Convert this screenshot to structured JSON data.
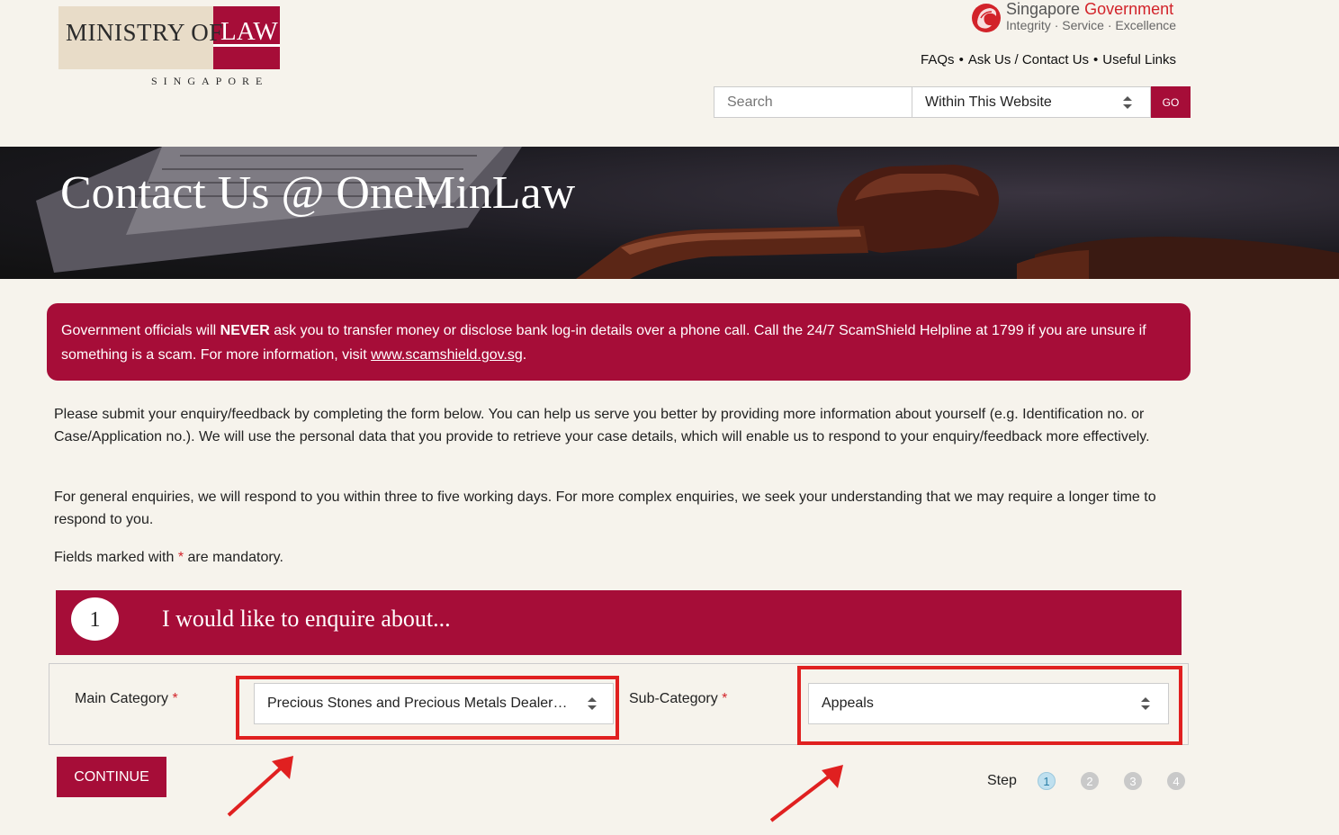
{
  "header": {
    "logo": {
      "ministry": "MINISTRY OF",
      "law": "LAW",
      "country": "SINGAPORE"
    },
    "sg_gov": {
      "name_part1": "Singapore",
      "name_part2": "Government",
      "motto": "Integrity · Service · Excellence"
    },
    "links": [
      "FAQs",
      "Ask Us / Contact Us",
      "Useful Links"
    ],
    "search": {
      "placeholder": "Search",
      "scope": "Within This Website",
      "go_label": "GO"
    }
  },
  "banner": {
    "title": "Contact Us @ OneMinLaw"
  },
  "alert": {
    "text_before": "Government officials will ",
    "bold": "NEVER",
    "text_after": " ask you to transfer money or disclose bank log-in details over a phone call. Call the 24/7 ScamShield Helpline at 1799 if you are unsure if something is a scam. For more information, visit ",
    "link": "www.scamshield.gov.sg",
    "end": "."
  },
  "intro": {
    "p1": "Please submit your enquiry/feedback by completing the form below. You can help us serve you better by providing more information about yourself (e.g. Identification no. or Case/Application no.). We will use the personal data that you provide to retrieve your case details, which will enable us to respond to your enquiry/feedback more effectively.",
    "p2": "For general enquiries, we will respond to you within three to five working days. For more complex enquiries, we seek your understanding that we may require a longer time to respond to you.",
    "p3_before": "Fields marked with ",
    "p3_star": "*",
    "p3_after": " are mandatory."
  },
  "step_section": {
    "number": "1",
    "title": "I would like to enquire about..."
  },
  "form": {
    "main_category_label": "Main Category",
    "main_category_value": "Precious Stones and Precious Metals Dealer…",
    "sub_category_label": "Sub-Category",
    "sub_category_value": "Appeals",
    "required_mark": "*",
    "continue_label": "CONTINUE"
  },
  "steps": {
    "label": "Step",
    "items": [
      "1",
      "2",
      "3",
      "4"
    ],
    "current": 1
  },
  "colors": {
    "brand": "#a60d38",
    "background": "#f6f3ec",
    "highlight": "#e02020"
  }
}
